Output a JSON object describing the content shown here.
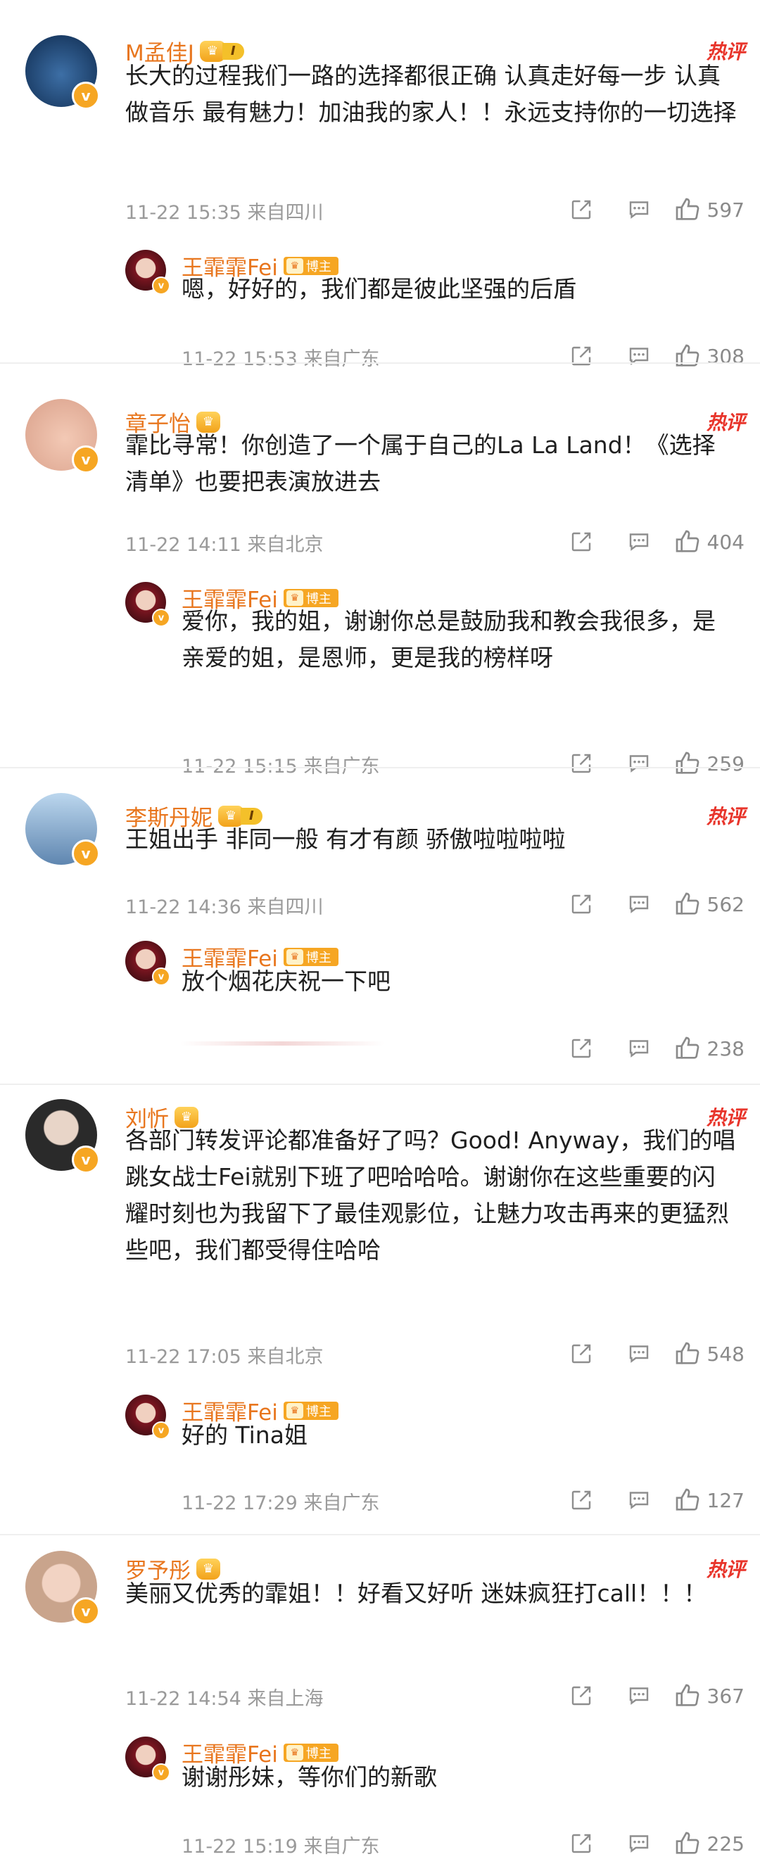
{
  "colors": {
    "name": "#e8761e",
    "hot": "#e8352b",
    "meta": "#9a9a9a",
    "vip": "#f6a623"
  },
  "hot_label": "热评",
  "host_label": "博主",
  "threads": [
    {
      "user": "M孟佳J",
      "level": "I",
      "text": "长大的过程我们一路的选择都很正确 认真走好每一步 认真做音乐 最有魅力！加油我的家人！！永远支持你的一切选择",
      "time": "11-22 15:35",
      "location": "来自四川",
      "likes": "597",
      "reply": {
        "user": "王霏霏Fei",
        "text": "嗯，好好的，我们都是彼此坚强的后盾",
        "time": "11-22 15:53",
        "location": "来自广东",
        "likes": "308"
      }
    },
    {
      "user": "章子怡",
      "level": "",
      "text": "霏比寻常！你创造了一个属于自己的La La Land！《选择清单》也要把表演放进去",
      "time": "11-22 14:11",
      "location": "来自北京",
      "likes": "404",
      "reply": {
        "user": "王霏霏Fei",
        "text": "爱你，我的姐，谢谢你总是鼓励我和教会我很多，是亲爱的姐，是恩师，更是我的榜样呀",
        "time": "11-22 15:15",
        "location": "来自广东",
        "likes": "259"
      }
    },
    {
      "user": "李斯丹妮",
      "level": "I",
      "text": "王姐出手 非同一般 有才有颜 骄傲啦啦啦啦",
      "time": "11-22 14:36",
      "location": "来自四川",
      "likes": "562",
      "reply": {
        "user": "王霏霏Fei",
        "text": "放个烟花庆祝一下吧",
        "time": "",
        "location": "",
        "likes": "238"
      }
    },
    {
      "user": "刘忻",
      "level": "",
      "text": "各部门转发评论都准备好了吗？Good! Anyway，我们的唱跳女战士Fei就别下班了吧哈哈哈。谢谢你在这些重要的闪耀时刻也为我留下了最佳观影位，让魅力攻击再来的更猛烈些吧，我们都受得住哈哈",
      "time": "11-22 17:05",
      "location": "来自北京",
      "likes": "548",
      "reply": {
        "user": "王霏霏Fei",
        "text": "好的 Tina姐",
        "time": "11-22 17:29",
        "location": "来自广东",
        "likes": "127"
      }
    },
    {
      "user": "罗予彤",
      "level": "",
      "text": "美丽又优秀的霏姐！！好看又好听 迷妹疯狂打call！！！",
      "time": "11-22 14:54",
      "location": "来自上海",
      "likes": "367",
      "reply": {
        "user": "王霏霏Fei",
        "text": "谢谢彤妹，等你们的新歌",
        "time": "11-22 15:19",
        "location": "来自广东",
        "likes": "225"
      }
    }
  ]
}
